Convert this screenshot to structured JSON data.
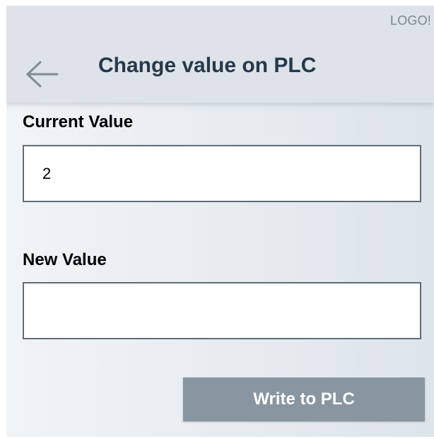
{
  "header": {
    "brand": "LOGO!",
    "title": "Change value on PLC",
    "back_icon": "arrow-left-icon"
  },
  "current_value": {
    "label": "Current Value",
    "value": "2"
  },
  "new_value": {
    "label": "New Value",
    "value": "",
    "placeholder": ""
  },
  "actions": {
    "write_label": "Write to PLC"
  },
  "colors": {
    "header_bg": "#dde3e8",
    "title": "#25394b",
    "button_bg": "#8896a1",
    "field_border": "#606d78"
  }
}
